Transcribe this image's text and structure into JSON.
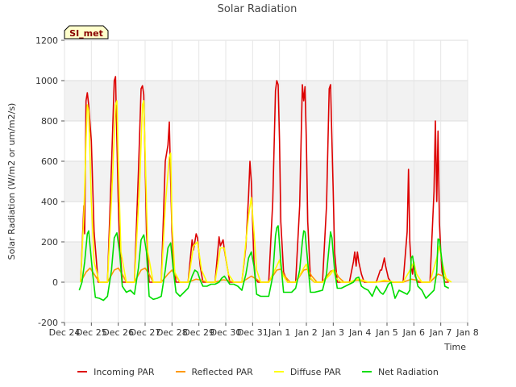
{
  "chart_data": {
    "type": "line",
    "title": "Solar Radiation",
    "xlabel": "Time",
    "ylabel": "Solar Radiation (W/m2 or um/m2/s)",
    "ylim": [
      -200,
      1200
    ],
    "yticks": [
      -200,
      0,
      200,
      400,
      600,
      800,
      1000,
      1200
    ],
    "xlim": [
      0,
      15
    ],
    "xticks": [
      {
        "x": 0,
        "label": "Dec 24"
      },
      {
        "x": 1,
        "label": "Dec 25"
      },
      {
        "x": 2,
        "label": "Dec 26"
      },
      {
        "x": 3,
        "label": "Dec 27"
      },
      {
        "x": 4,
        "label": "Dec 28"
      },
      {
        "x": 5,
        "label": "Dec 29"
      },
      {
        "x": 6,
        "label": "Dec 30"
      },
      {
        "x": 7,
        "label": "Dec 31"
      },
      {
        "x": 8,
        "label": "Jan 1"
      },
      {
        "x": 9,
        "label": "Jan 2"
      },
      {
        "x": 10,
        "label": "Jan 3"
      },
      {
        "x": 11,
        "label": "Jan 4"
      },
      {
        "x": 12,
        "label": "Jan 5"
      },
      {
        "x": 13,
        "label": "Jan 6"
      },
      {
        "x": 14,
        "label": "Jan 7"
      },
      {
        "x": 15,
        "label": "Jan 8"
      }
    ],
    "annotation": "SI_met",
    "legend_position": "bottom",
    "grid": true,
    "series": [
      {
        "name": "Incoming PAR",
        "color": "#dd0000",
        "x": [
          0.6,
          0.72,
          0.75,
          0.8,
          0.85,
          0.9,
          1.0,
          1.1,
          1.25,
          1.6,
          1.75,
          1.85,
          1.9,
          1.95,
          2.0,
          2.05,
          2.15,
          2.3,
          2.6,
          2.75,
          2.85,
          2.9,
          2.95,
          3.0,
          3.05,
          3.15,
          3.3,
          3.6,
          3.75,
          3.85,
          3.9,
          3.95,
          4.0,
          4.05,
          4.15,
          4.3,
          4.6,
          4.75,
          4.8,
          4.9,
          4.95,
          5.05,
          5.15,
          5.3,
          5.6,
          5.75,
          5.8,
          5.9,
          5.95,
          6.05,
          6.15,
          6.3,
          6.6,
          6.75,
          6.85,
          6.9,
          6.95,
          7.0,
          7.05,
          7.1,
          7.2,
          7.3,
          7.6,
          7.75,
          7.85,
          7.9,
          7.95,
          8.0,
          8.05,
          8.15,
          8.3,
          8.6,
          8.75,
          8.85,
          8.9,
          8.95,
          9.0,
          9.05,
          9.15,
          9.3,
          9.6,
          9.75,
          9.85,
          9.9,
          9.95,
          10.0,
          10.05,
          10.15,
          10.3,
          10.6,
          10.75,
          10.8,
          10.85,
          10.9,
          10.95,
          11.05,
          11.15,
          11.3,
          11.6,
          11.75,
          11.8,
          11.9,
          11.95,
          12.05,
          12.15,
          12.3,
          12.6,
          12.75,
          12.8,
          12.85,
          12.9,
          12.95,
          13.0,
          13.05,
          13.15,
          13.3,
          13.6,
          13.75,
          13.8,
          13.85,
          13.9,
          13.95,
          14.0,
          14.05,
          14.15,
          14.3
        ],
        "y": [
          0,
          380,
          240,
          900,
          940,
          880,
          700,
          250,
          0,
          0,
          580,
          1000,
          1020,
          700,
          400,
          200,
          0,
          0,
          0,
          550,
          960,
          975,
          930,
          600,
          250,
          0,
          0,
          0,
          600,
          680,
          795,
          500,
          250,
          100,
          0,
          0,
          0,
          210,
          160,
          240,
          220,
          80,
          0,
          0,
          0,
          225,
          180,
          210,
          160,
          80,
          0,
          0,
          0,
          180,
          430,
          600,
          500,
          300,
          100,
          20,
          0,
          0,
          0,
          400,
          950,
          1000,
          980,
          700,
          300,
          50,
          0,
          0,
          380,
          980,
          900,
          970,
          700,
          300,
          20,
          0,
          0,
          380,
          960,
          980,
          700,
          450,
          150,
          0,
          0,
          0,
          100,
          150,
          80,
          150,
          100,
          40,
          0,
          0,
          0,
          60,
          60,
          120,
          80,
          20,
          0,
          0,
          0,
          250,
          560,
          200,
          80,
          40,
          100,
          30,
          0,
          0,
          0,
          450,
          800,
          400,
          750,
          300,
          150,
          50,
          0,
          0
        ]
      },
      {
        "name": "Reflected PAR",
        "color": "#ff9900",
        "x": [
          0.6,
          0.8,
          0.95,
          1.1,
          1.3,
          1.6,
          1.85,
          2.0,
          2.15,
          2.3,
          2.6,
          2.85,
          3.0,
          3.15,
          3.3,
          3.6,
          3.85,
          4.0,
          4.15,
          4.3,
          4.6,
          4.9,
          5.1,
          5.3,
          5.6,
          5.9,
          6.1,
          6.3,
          6.6,
          6.95,
          7.15,
          7.3,
          7.6,
          7.9,
          8.05,
          8.2,
          8.4,
          8.6,
          8.9,
          9.05,
          9.2,
          9.4,
          9.6,
          9.9,
          10.05,
          10.2,
          10.4,
          10.6,
          10.9,
          11.1,
          11.3,
          11.6,
          11.9,
          12.1,
          12.3,
          12.6,
          12.9,
          13.1,
          13.3,
          13.6,
          13.9,
          14.1,
          14.3
        ],
        "y": [
          0,
          50,
          70,
          40,
          0,
          0,
          60,
          70,
          40,
          0,
          0,
          60,
          70,
          40,
          0,
          0,
          40,
          60,
          30,
          0,
          0,
          15,
          10,
          0,
          0,
          12,
          8,
          0,
          0,
          30,
          15,
          0,
          0,
          60,
          65,
          30,
          0,
          0,
          60,
          65,
          30,
          0,
          0,
          55,
          60,
          25,
          0,
          0,
          10,
          5,
          0,
          0,
          5,
          3,
          0,
          0,
          15,
          10,
          0,
          0,
          40,
          30,
          0
        ]
      },
      {
        "name": "Diffuse PAR",
        "color": "#ffff00",
        "x": [
          0.6,
          0.72,
          0.8,
          0.85,
          0.9,
          1.0,
          1.1,
          1.3,
          1.6,
          1.8,
          1.9,
          1.95,
          2.0,
          2.1,
          2.3,
          2.6,
          2.8,
          2.9,
          2.95,
          3.0,
          3.1,
          3.3,
          3.6,
          3.75,
          3.9,
          3.95,
          4.0,
          4.1,
          4.3,
          4.6,
          4.8,
          4.95,
          5.1,
          5.3,
          5.6,
          5.8,
          5.95,
          6.1,
          6.3,
          6.6,
          6.85,
          6.95,
          7.05,
          7.15,
          7.3,
          7.6,
          7.9,
          8.0,
          8.1,
          8.3,
          8.6,
          8.9,
          9.0,
          9.1,
          9.3,
          9.6,
          9.9,
          10.0,
          10.1,
          10.3,
          10.6,
          10.9,
          11.1,
          11.3,
          11.6,
          11.9,
          12.1,
          12.3,
          12.6,
          12.9,
          13.0,
          13.1,
          13.3,
          13.6,
          13.85,
          13.95,
          14.05,
          14.2,
          14.4
        ],
        "y": [
          0,
          330,
          700,
          880,
          850,
          400,
          100,
          0,
          0,
          560,
          880,
          900,
          600,
          150,
          0,
          0,
          500,
          880,
          900,
          650,
          150,
          0,
          0,
          380,
          620,
          640,
          300,
          50,
          0,
          0,
          180,
          200,
          60,
          0,
          0,
          170,
          170,
          40,
          0,
          0,
          330,
          420,
          250,
          60,
          0,
          0,
          80,
          110,
          40,
          0,
          0,
          70,
          90,
          30,
          0,
          0,
          40,
          60,
          20,
          0,
          0,
          15,
          10,
          0,
          0,
          10,
          5,
          0,
          0,
          70,
          100,
          40,
          0,
          0,
          120,
          180,
          100,
          20,
          0
        ]
      },
      {
        "name": "Net Radiation",
        "color": "#00dd00",
        "x": [
          0.55,
          0.65,
          0.75,
          0.85,
          0.9,
          0.95,
          1.05,
          1.15,
          1.3,
          1.45,
          1.6,
          1.75,
          1.85,
          1.95,
          2.05,
          2.15,
          2.3,
          2.45,
          2.6,
          2.75,
          2.85,
          2.95,
          3.05,
          3.15,
          3.3,
          3.45,
          3.6,
          3.75,
          3.85,
          3.95,
          4.05,
          4.15,
          4.3,
          4.45,
          4.6,
          4.75,
          4.85,
          4.95,
          5.05,
          5.15,
          5.3,
          5.45,
          5.6,
          5.75,
          5.85,
          5.95,
          6.05,
          6.15,
          6.3,
          6.45,
          6.6,
          6.75,
          6.85,
          6.95,
          7.05,
          7.15,
          7.3,
          7.45,
          7.6,
          7.75,
          7.85,
          7.9,
          7.95,
          8.05,
          8.15,
          8.3,
          8.45,
          8.6,
          8.75,
          8.85,
          8.9,
          8.95,
          9.05,
          9.15,
          9.3,
          9.45,
          9.6,
          9.75,
          9.85,
          9.9,
          9.95,
          10.05,
          10.15,
          10.3,
          10.45,
          10.6,
          10.75,
          10.85,
          10.95,
          11.05,
          11.15,
          11.3,
          11.45,
          11.6,
          11.75,
          11.85,
          11.95,
          12.05,
          12.15,
          12.3,
          12.45,
          12.6,
          12.75,
          12.85,
          12.9,
          12.95,
          13.05,
          13.15,
          13.3,
          13.45,
          13.6,
          13.75,
          13.85,
          13.9,
          13.95,
          14.05,
          14.15,
          14.3
        ],
        "y": [
          -40,
          0,
          100,
          240,
          255,
          180,
          40,
          -75,
          -80,
          -90,
          -70,
          60,
          220,
          245,
          150,
          -20,
          -50,
          -40,
          -60,
          70,
          210,
          235,
          150,
          -70,
          -85,
          -80,
          -70,
          60,
          170,
          195,
          60,
          -50,
          -70,
          -50,
          -30,
          30,
          60,
          50,
          10,
          -20,
          -20,
          -10,
          -10,
          0,
          20,
          30,
          10,
          -10,
          -10,
          -20,
          -40,
          40,
          120,
          150,
          80,
          -60,
          -70,
          -70,
          -70,
          30,
          230,
          270,
          280,
          100,
          -50,
          -50,
          -50,
          -30,
          60,
          200,
          255,
          250,
          100,
          -50,
          -50,
          -45,
          -40,
          40,
          180,
          250,
          220,
          60,
          -30,
          -30,
          -20,
          -10,
          0,
          20,
          25,
          -20,
          -30,
          -40,
          -70,
          -20,
          -50,
          -60,
          -40,
          -10,
          0,
          -80,
          -40,
          -50,
          -60,
          -40,
          120,
          130,
          40,
          -20,
          -40,
          -80,
          -60,
          -40,
          50,
          215,
          210,
          100,
          -20,
          -30
        ]
      }
    ]
  }
}
